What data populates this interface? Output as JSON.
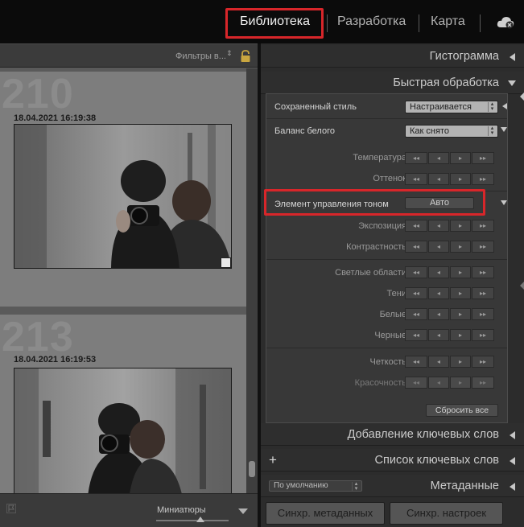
{
  "modules": {
    "library": "Библиотека",
    "develop": "Разработка",
    "map": "Карта"
  },
  "filterbar": {
    "filter_label": "Фильтры в...",
    "arrows": "⇕"
  },
  "grid": {
    "cells": [
      {
        "number": "210",
        "date": "18.04.2021 16:19:38"
      },
      {
        "number": "213",
        "date": "18.04.2021 16:19:53"
      }
    ]
  },
  "bottombar": {
    "thumbnails_label": "Миниатюры"
  },
  "panels": {
    "histogram": "Гистограмма",
    "quick_develop": "Быстрая обработка",
    "keywording": "Добавление ключевых слов",
    "keyword_list": "Список ключевых слов",
    "metadata": "Метаданные"
  },
  "quick_develop": {
    "saved_preset_label": "Сохраненный стиль",
    "saved_preset_value": "Настраивается",
    "white_balance_label": "Баланс белого",
    "white_balance_value": "Как снято",
    "temperature": "Температура",
    "tint": "Оттенок",
    "tone_control_label": "Элемент управления тоном",
    "auto_button": "Авто",
    "exposure": "Экспозиция",
    "contrast": "Контрастность",
    "highlights": "Светлые области",
    "shadows": "Тени",
    "whites": "Белые",
    "blacks": "Черные",
    "clarity": "Четкость",
    "vibrance": "Красочность",
    "reset_all": "Сбросить все",
    "btn_glyphs": [
      "◂◂",
      "◂",
      "▸",
      "▸▸"
    ]
  },
  "metadata": {
    "preset_value": "По умолчанию"
  },
  "sync": {
    "sync_metadata": "Синхр. метаданных",
    "sync_settings": "Синхр. настроек"
  },
  "colors": {
    "highlight_red": "#d8262a",
    "panel_bg": "#2c2c2c",
    "grid_bg": "#5b5b5b"
  }
}
